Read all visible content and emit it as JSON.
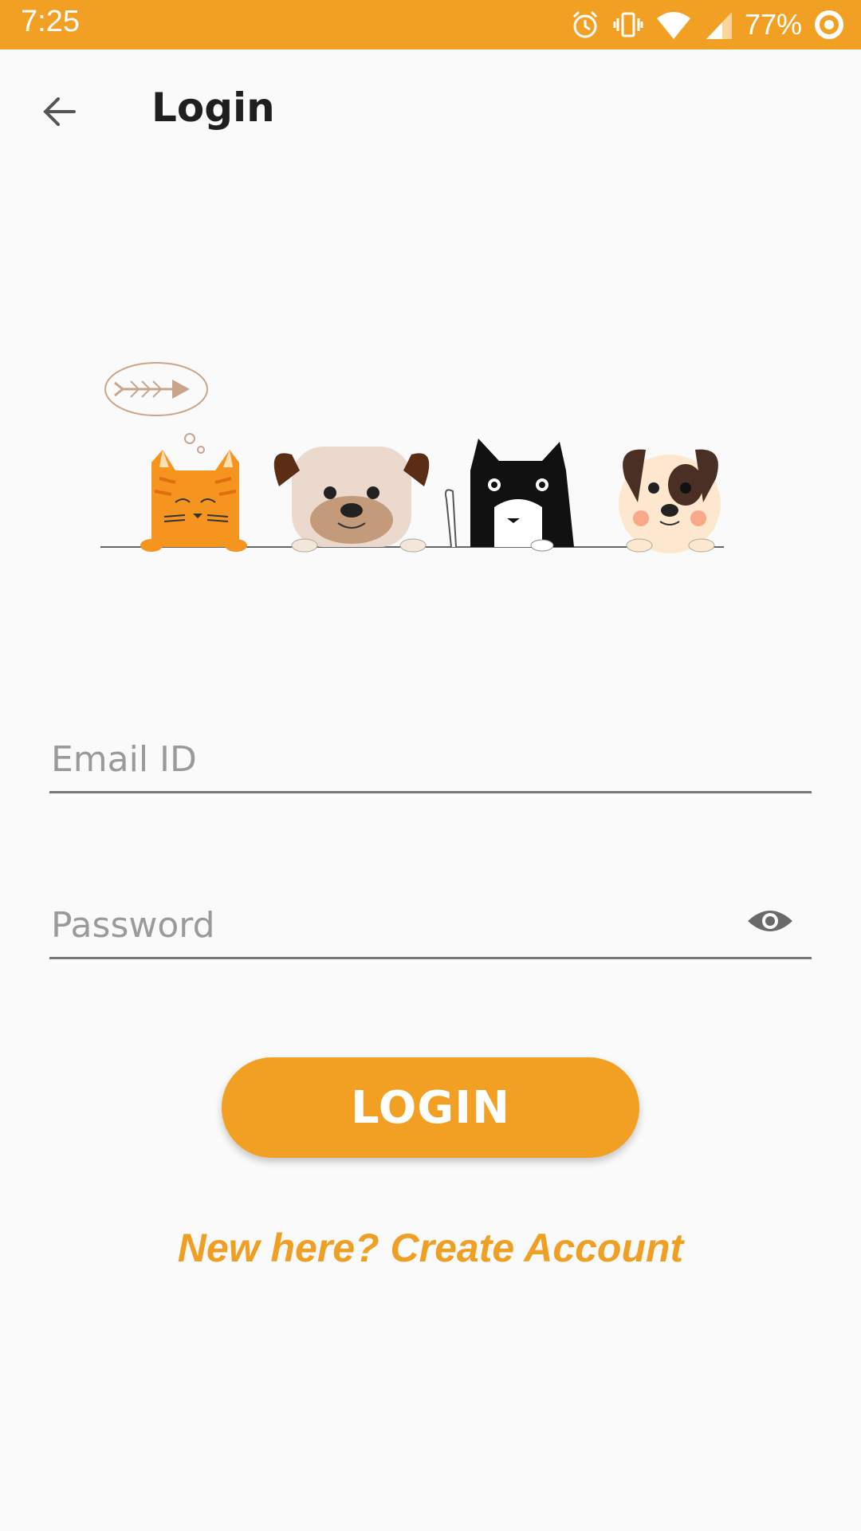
{
  "status_bar": {
    "time": "7:25",
    "battery": "77%",
    "icons": [
      "alarm-icon",
      "vibrate-icon",
      "wifi-icon",
      "signal-icon",
      "battery-icon"
    ],
    "background": "#f2a023"
  },
  "app_bar": {
    "title": "Login",
    "back_icon": "arrow-left-icon"
  },
  "illustration": {
    "description_icon": "cats-and-dogs-illustration"
  },
  "form": {
    "email": {
      "placeholder": "Email ID",
      "value": ""
    },
    "password": {
      "placeholder": "Password",
      "value": "",
      "toggle_icon": "eye-icon"
    },
    "login_label": "LOGIN",
    "create_account_label": "New here? Create Account"
  },
  "colors": {
    "accent": "#f2a023",
    "link": "#ef9f23",
    "background": "#fafafa"
  }
}
